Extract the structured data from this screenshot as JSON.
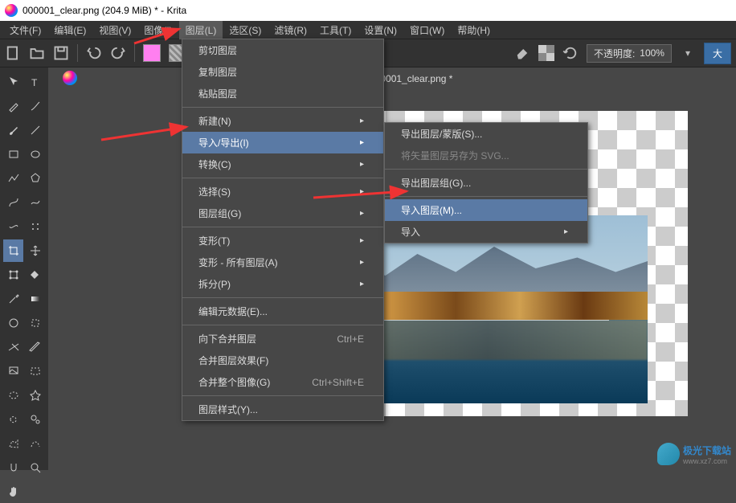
{
  "title": "000001_clear.png (204.9 MiB)  * - Krita",
  "menubar": [
    "文件(F)",
    "编辑(E)",
    "视图(V)",
    "图像(I)",
    "图层(L)",
    "选区(S)",
    "滤镜(R)",
    "工具(T)",
    "设置(N)",
    "窗口(W)",
    "帮助(H)"
  ],
  "active_menu_index": 4,
  "tab": "000001_clear.png *",
  "opacity_label": "不透明度:",
  "opacity_value": "100%",
  "end_button": "大",
  "menu1": {
    "items": [
      {
        "label": "剪切图层",
        "key": "cut-layer"
      },
      {
        "label": "复制图层",
        "key": "copy-layer"
      },
      {
        "label": "粘贴图层",
        "key": "paste-layer"
      },
      {
        "type": "sep"
      },
      {
        "label": "新建(N)",
        "key": "new",
        "sub": true
      },
      {
        "label": "导入/导出(I)",
        "key": "import-export",
        "sub": true,
        "hl": true
      },
      {
        "label": "转换(C)",
        "key": "convert",
        "sub": true
      },
      {
        "type": "sep"
      },
      {
        "label": "选择(S)",
        "key": "select",
        "sub": true
      },
      {
        "label": "图层组(G)",
        "key": "group",
        "sub": true
      },
      {
        "type": "sep"
      },
      {
        "label": "变形(T)",
        "key": "transform",
        "sub": true
      },
      {
        "label": "变形 - 所有图层(A)",
        "key": "transform-all",
        "sub": true
      },
      {
        "label": "拆分(P)",
        "key": "split",
        "sub": true
      },
      {
        "type": "sep"
      },
      {
        "label": "编辑元数据(E)...",
        "key": "metadata"
      },
      {
        "type": "sep"
      },
      {
        "label": "向下合并图层",
        "key": "merge-down",
        "shortcut": "Ctrl+E"
      },
      {
        "label": "合并图层效果(F)",
        "key": "flatten-fx"
      },
      {
        "label": "合并整个图像(G)",
        "key": "flatten-image",
        "shortcut": "Ctrl+Shift+E"
      },
      {
        "type": "sep"
      },
      {
        "label": "图层样式(Y)...",
        "key": "layer-style"
      }
    ]
  },
  "menu2": {
    "items": [
      {
        "label": "导出图层/蒙版(S)...",
        "key": "export-layer"
      },
      {
        "label": "将矢量图层另存为 SVG...",
        "key": "save-svg",
        "disabled": true
      },
      {
        "type": "sep"
      },
      {
        "label": "导出图层组(G)...",
        "key": "export-group"
      },
      {
        "type": "sep"
      },
      {
        "label": "导入图层(M)...",
        "key": "import-layer",
        "hl": true
      },
      {
        "label": "导入",
        "key": "import",
        "sub": true
      }
    ]
  },
  "tools": [
    "cursor",
    "text",
    "edit",
    "picker",
    "brush",
    "line",
    "rect",
    "ellipse",
    "polyline",
    "shape",
    "curve",
    "freehand",
    "pan",
    "perspective",
    "crop",
    "multigrid",
    "transform",
    "move",
    "fill",
    "gradient",
    "smart",
    "contiguous",
    "assist",
    "measure",
    "ref",
    "zoom",
    "rect-sel",
    "cont-sel",
    "similar",
    "free-sel",
    "poly-sel",
    "bezier",
    "magnet",
    "hand",
    "zoom2"
  ],
  "watermark_name": "极光下载站",
  "watermark_url": "www.xz7.com"
}
